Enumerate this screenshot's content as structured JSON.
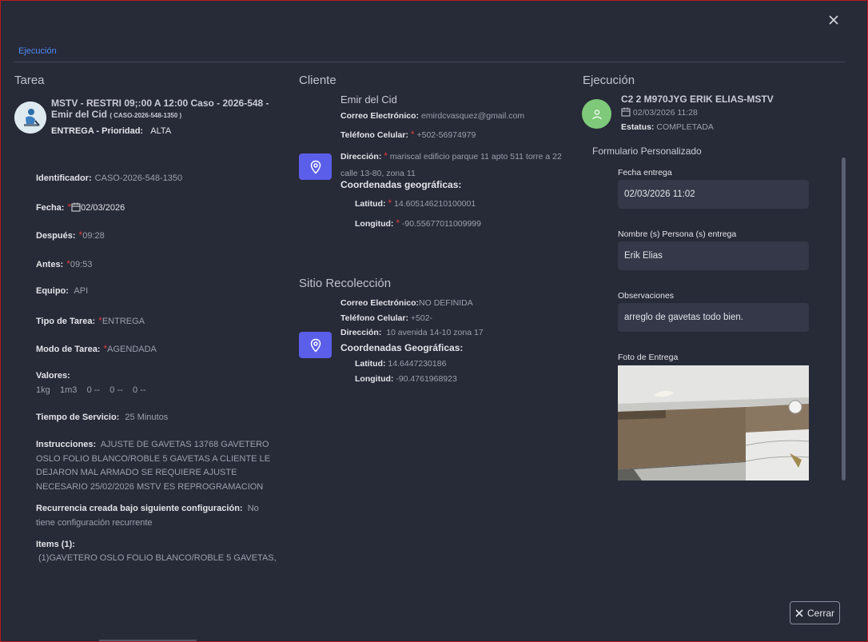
{
  "tab": {
    "label": "Ejecución"
  },
  "tarea": {
    "section_title": "Tarea",
    "title": "MSTV - RESTRI 09;:00 A 12:00 Caso - 2026-548 - Emir del Cid",
    "case_code": "( CASO-2026-548-1350 )",
    "type_priority_label": "ENTREGA - Prioridad:",
    "priority": "ALTA",
    "identificador_label": "Identificador:",
    "identificador": "CASO-2026-548-1350",
    "fecha_label": "Fecha:",
    "fecha": "02/03/2026",
    "despues_label": "Después:",
    "despues": "09:28",
    "antes_label": "Antes:",
    "antes": "09:53",
    "equipo_label": "Equipo:",
    "equipo": "API",
    "tipo_label": "Tipo de Tarea:",
    "tipo": "ENTREGA",
    "modo_label": "Modo de Tarea:",
    "modo": "AGENDADA",
    "valores_label": "Valores:",
    "valores": "1kg    1m3    0 --    0 --    0 --",
    "tiempo_label": "Tiempo de Servicio:",
    "tiempo": "25 Minutos",
    "instrucciones_label": "Instrucciones:",
    "instrucciones": "AJUSTE DE GAVETAS 13768 GAVETERO OSLO FOLIO BLANCO/ROBLE 5 GAVETAS A CLIENTE LE DEJARON MAL ARMADO SE REQUIERE AJUSTE NECESARIO 25/02/2026 MSTV ES REPROGRAMACION",
    "recurrencia_label": "Recurrencia creada bajo siguiente configuración:",
    "recurrencia": "No tiene configuración recurrente",
    "items_label": "Items (1):",
    "items": "(1)GAVETERO OSLO FOLIO BLANCO/ROBLE 5 GAVETAS,"
  },
  "cliente": {
    "section_title": "Cliente",
    "name": "Emir del Cid",
    "correo_label": "Correo Electrónico:",
    "correo": "emirdcvasquez@gmail.com",
    "telefono_label": "Teléfono Celular:",
    "telefono": "+502-56974979",
    "direccion_label": "Dirección:",
    "direccion": "mariscal edificio parque 11 apto 511 torre a 22 calle 13-80, zona 11",
    "coords_label": "Coordenadas geográficas:",
    "latitud_label": "Latitud:",
    "latitud": "14.605146210100001",
    "longitud_label": "Longitud:",
    "longitud": "-90.55677011009999"
  },
  "sitio": {
    "section_title": "Sitio Recolección",
    "correo_label": "Correo Electrónico:",
    "correo": "NO DEFINIDA",
    "telefono_label": "Teléfono Celular:",
    "telefono": "+502-",
    "direccion_label": "Dirección:",
    "direccion": "10 avenida 14-10 zona 17",
    "coords_label": "Coordenadas Geográficas:",
    "latitud_label": "Latitud:",
    "latitud": "14.6447230186",
    "longitud_label": "Longitud:",
    "longitud": "-90.4761968923"
  },
  "ejecucion": {
    "section_title": "Ejecución",
    "name": "C2 2 M970JYG ERIK ELIAS-MSTV",
    "date": "02/03/2026 11:28",
    "estatus_label": "Estatus:",
    "estatus": "COMPLETADA",
    "form_title": "Formulario Personalizado",
    "fecha_entrega_label": "Fecha entrega",
    "fecha_entrega": "02/03/2026 11:02",
    "persona_label": "Nombre (s) Persona (s) entrega",
    "persona": "Erik Elias",
    "observaciones_label": "Observaciones",
    "observaciones": "arreglo de gavetas todo bien.",
    "foto_label": "Foto de Entrega"
  },
  "footer": {
    "cerrar_label": "Cerrar"
  },
  "colors": {
    "accent": "#5b5ee8",
    "link": "#4f8cf7",
    "required": "#e03b3b",
    "avatar_green": "#7ec97a",
    "border": "#b91c1c"
  }
}
